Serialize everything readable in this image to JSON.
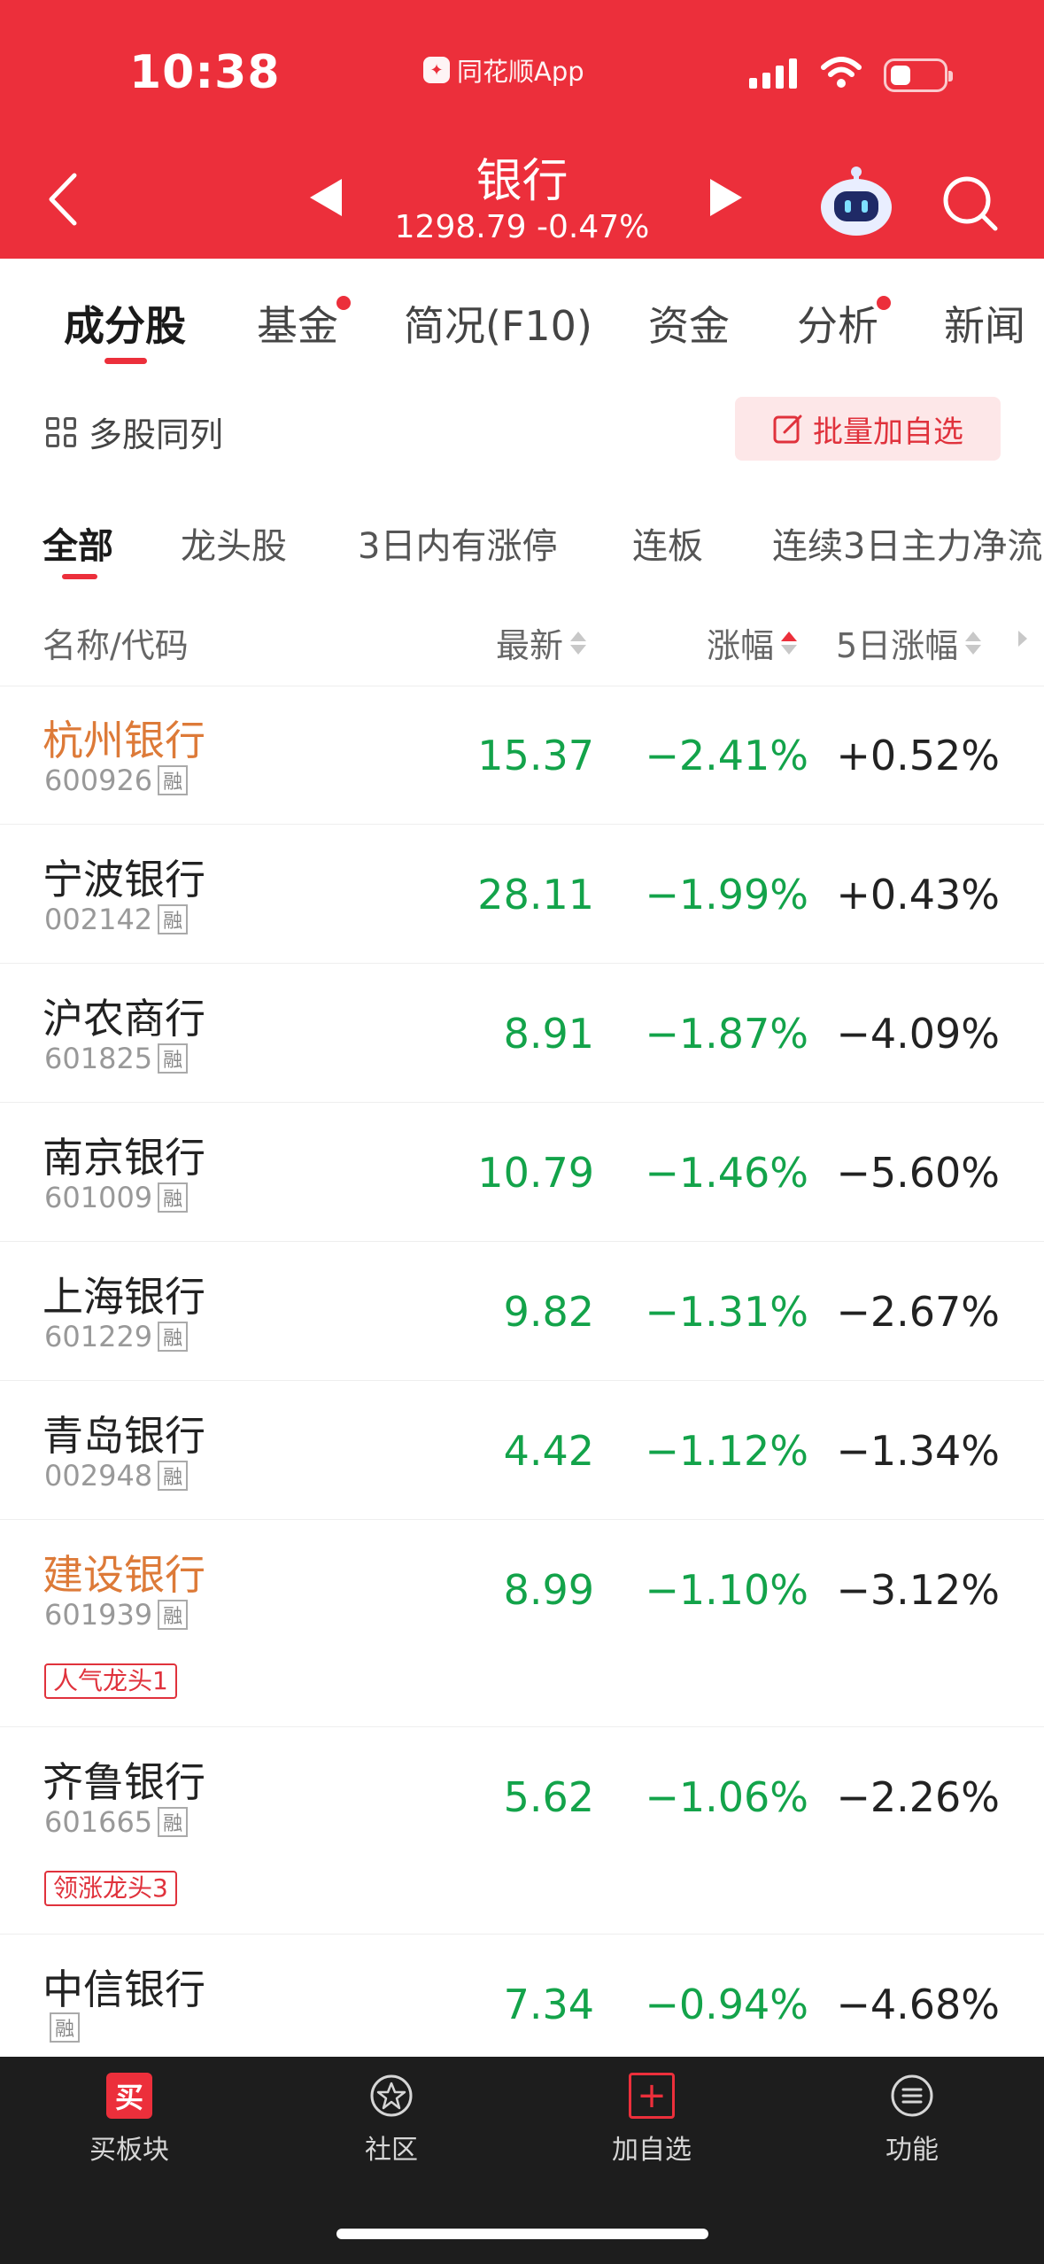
{
  "status_bar": {
    "time": "10:38",
    "app_name": "同花顺App"
  },
  "header": {
    "title": "银行",
    "index_value": "1298.79",
    "index_change": "-0.47%"
  },
  "tabs": [
    {
      "label": "成分股",
      "active": true,
      "dot": false
    },
    {
      "label": "基金",
      "active": false,
      "dot": true
    },
    {
      "label": "简况(F10)",
      "active": false,
      "dot": false
    },
    {
      "label": "资金",
      "active": false,
      "dot": false
    },
    {
      "label": "分析",
      "active": false,
      "dot": true
    },
    {
      "label": "新闻",
      "active": false,
      "dot": false
    }
  ],
  "toolbar": {
    "multi_list_label": "多股同列",
    "batch_add_label": "批量加自选"
  },
  "filters": [
    "全部",
    "龙头股",
    "3日内有涨停",
    "连板",
    "连续3日主力净流"
  ],
  "columns": {
    "name": "名称/代码",
    "latest": "最新",
    "change": "涨幅",
    "change_5d": "5日涨幅"
  },
  "rong_tag": "融",
  "stocks": [
    {
      "name": "杭州银行",
      "code": "600926",
      "price": "15.37",
      "change": "−2.41%",
      "change5d": "+0.52%",
      "highlight": true,
      "badge": ""
    },
    {
      "name": "宁波银行",
      "code": "002142",
      "price": "28.11",
      "change": "−1.99%",
      "change5d": "+0.43%",
      "highlight": false,
      "badge": ""
    },
    {
      "name": "沪农商行",
      "code": "601825",
      "price": "8.91",
      "change": "−1.87%",
      "change5d": "−4.09%",
      "highlight": false,
      "badge": ""
    },
    {
      "name": "南京银行",
      "code": "601009",
      "price": "10.79",
      "change": "−1.46%",
      "change5d": "−5.60%",
      "highlight": false,
      "badge": ""
    },
    {
      "name": "上海银行",
      "code": "601229",
      "price": "9.82",
      "change": "−1.31%",
      "change5d": "−2.67%",
      "highlight": false,
      "badge": ""
    },
    {
      "name": "青岛银行",
      "code": "002948",
      "price": "4.42",
      "change": "−1.12%",
      "change5d": "−1.34%",
      "highlight": false,
      "badge": ""
    },
    {
      "name": "建设银行",
      "code": "601939",
      "price": "8.99",
      "change": "−1.10%",
      "change5d": "−3.12%",
      "highlight": true,
      "badge": "人气龙头1"
    },
    {
      "name": "齐鲁银行",
      "code": "601665",
      "price": "5.62",
      "change": "−1.06%",
      "change5d": "−2.26%",
      "highlight": false,
      "badge": "领涨龙头3"
    },
    {
      "name": "中信银行",
      "code": "",
      "price": "7.34",
      "change": "−0.94%",
      "change5d": "−4.68%",
      "highlight": false,
      "badge": ""
    }
  ],
  "bottom_nav": [
    {
      "label": "买板块",
      "icon": "buy-icon",
      "glyph": "买"
    },
    {
      "label": "社区",
      "icon": "community-icon",
      "glyph": ""
    },
    {
      "label": "加自选",
      "icon": "add-watchlist-icon",
      "glyph": "+"
    },
    {
      "label": "功能",
      "icon": "menu-icon",
      "glyph": ""
    }
  ],
  "colors": {
    "brand_red": "#ec2f3b",
    "down_green": "#13a34a",
    "highlight_orange": "#dd7a38"
  }
}
